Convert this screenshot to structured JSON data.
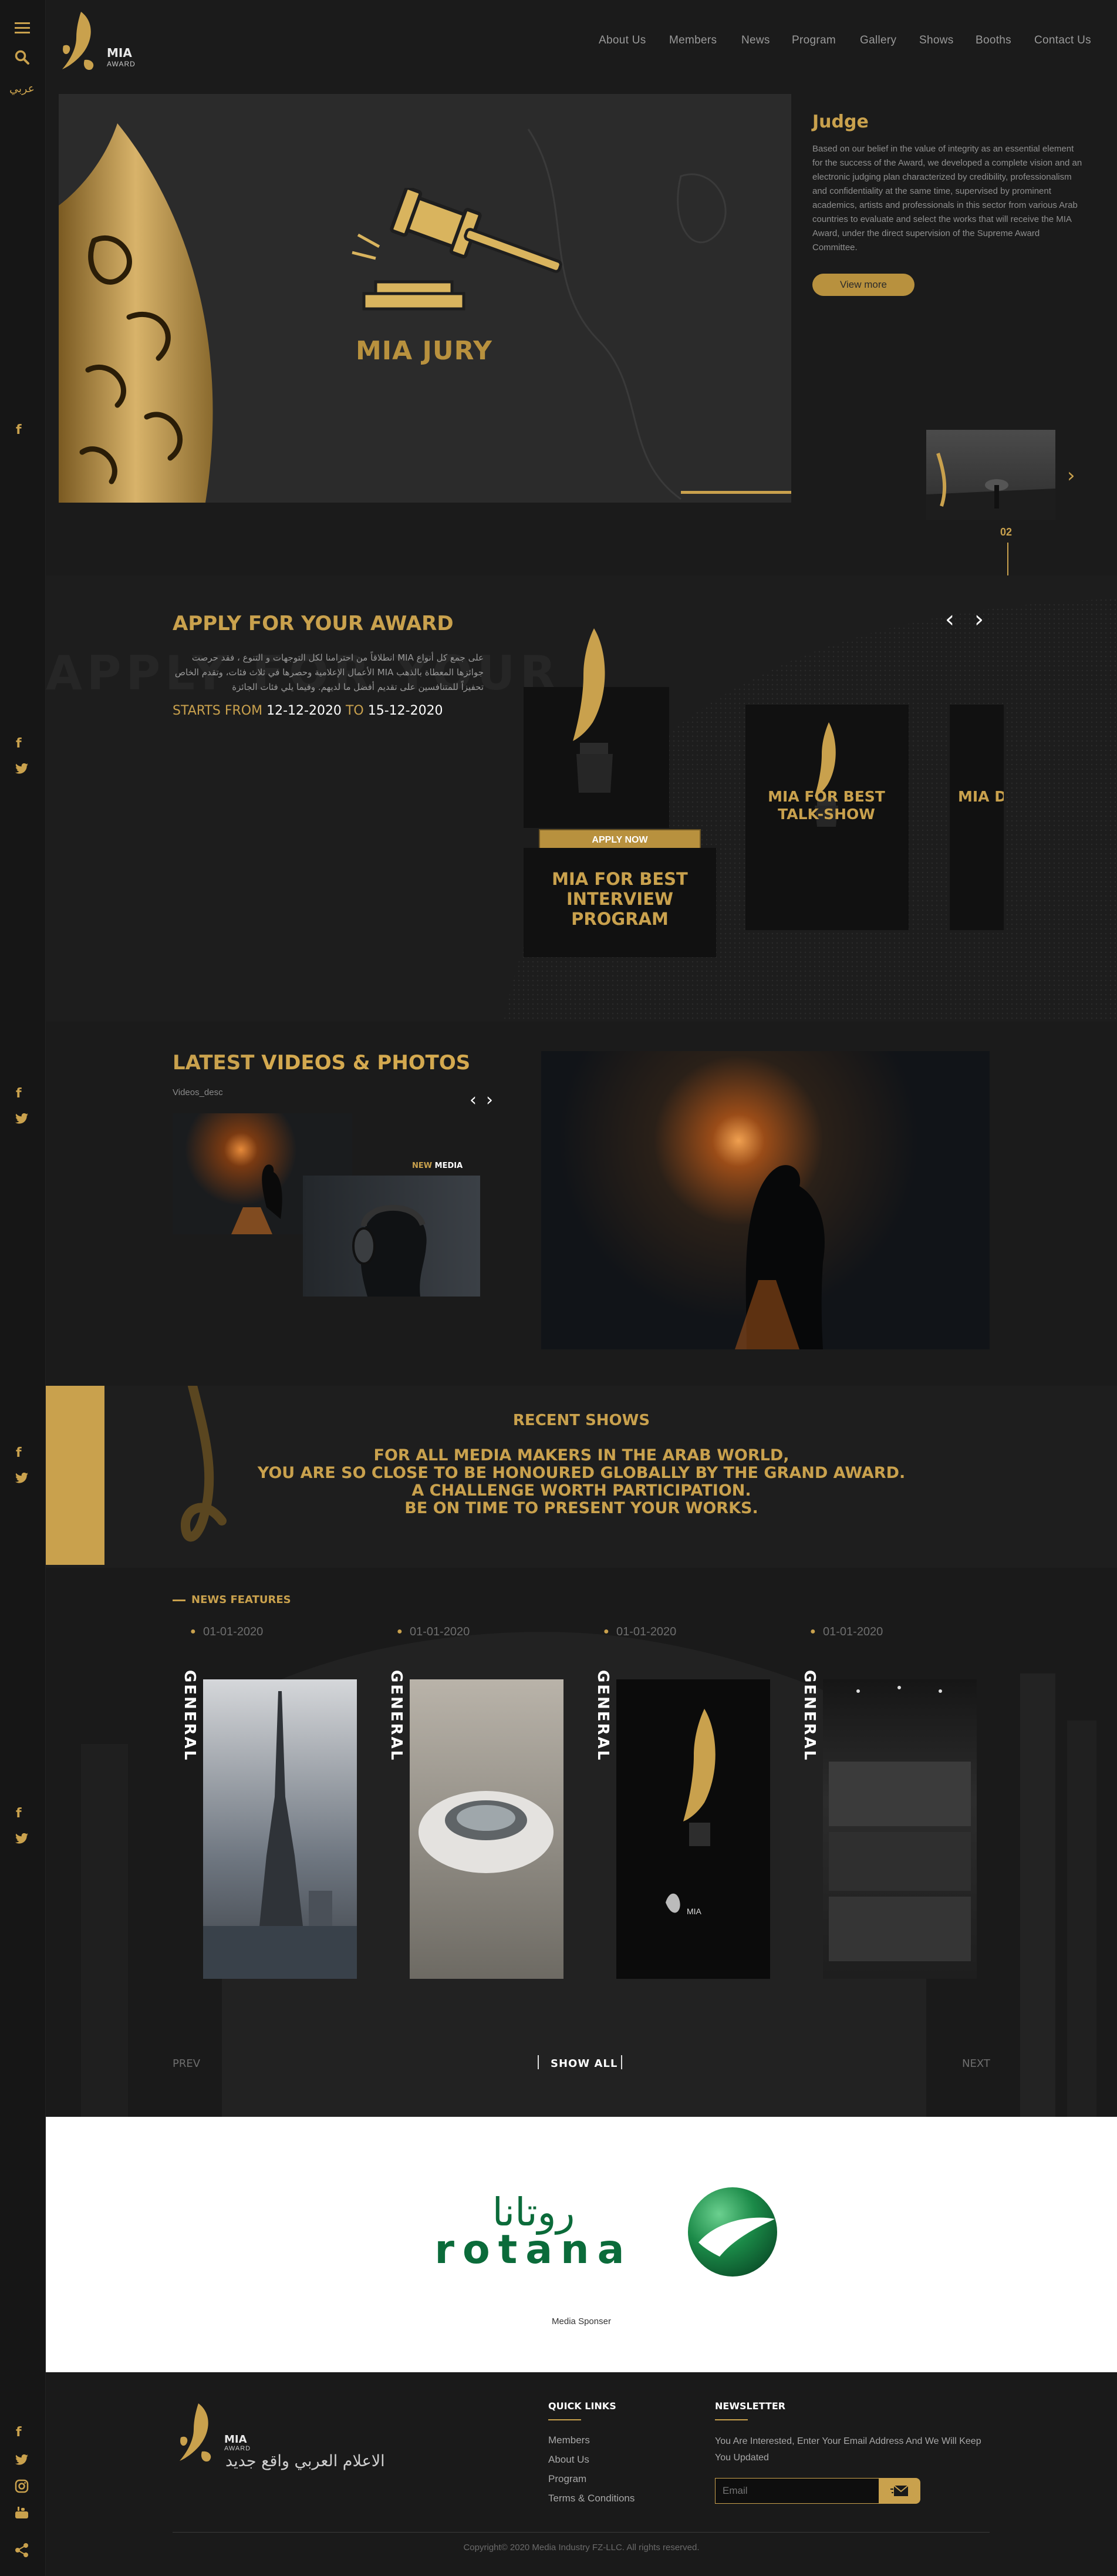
{
  "rail": {
    "menu_icon": "hamburger-icon",
    "search_icon": "search-icon",
    "lang": "عربي",
    "social_fb": "f"
  },
  "brand": {
    "name": "MIA",
    "sub": "AWARD"
  },
  "nav": [
    "About Us",
    "Members",
    "News",
    "Program",
    "Gallery",
    "Shows",
    "Booths",
    "Contact Us"
  ],
  "hero": {
    "caption": "MIA JURY",
    "title": "Judge",
    "text": "Based on our belief in the value of integrity as an essential element for the success of the Award, we developed a complete vision and an electronic judging plan characterized by credibility, professionalism and confidentiality at the same time, supervised by prominent academics, artists and professionals in this sector from various Arab countries to evaluate and select the works that will receive the MIA Award, under the direct supervision of the Supreme Award Committee.",
    "button": "View more",
    "slide_num": "02"
  },
  "apply": {
    "title": "APPLY FOR YOUR AWARD",
    "bg_text": "APPLY FOR YOUR",
    "arabic": "على جمع كل أنواع MIA انطلاقاً من احترامنا لكل التوجهات و التنوع ، فقد حرصت جوائزها المعطاة بالذهب MIA الأعمال الإعلامية وحصرها في ثلاث فئات، وتقدم الخاص تحفيزاً للمتنافسين على تقديم أفضل ما لديهم. وفيما يلي فئات الجائزة",
    "starts_label": "STARTS FROM",
    "start_date": "12-12-2020",
    "to_label": "TO",
    "end_date": "15-12-2020",
    "apply_btn": "APPLY NOW",
    "cards": [
      {
        "title": "MIA FOR BEST INTERVIEW PROGRAM"
      },
      {
        "title": "MIA FOR BEST TALK-SHOW"
      },
      {
        "title": "MIA DEBAT"
      }
    ]
  },
  "videos": {
    "title_gold": "LATEST",
    "title_white": "VIDEOS & PHOTOS",
    "desc": "Videos_desc",
    "new_label": "NEW",
    "media_label": "MEDIA"
  },
  "recent": {
    "title": "RECENT SHOWS",
    "lines": [
      "FOR ALL MEDIA MAKERS IN THE ARAB WORLD,",
      "YOU ARE SO CLOSE TO BE HONOURED GLOBALLY BY THE GRAND AWARD.",
      "A CHALLENGE WORTH PARTICIPATION.",
      "BE ON TIME TO PRESENT YOUR WORKS."
    ]
  },
  "news": {
    "title": "NEWS FEATURES",
    "items": [
      {
        "date": "01-01-2020",
        "category": "GENERAL"
      },
      {
        "date": "01-01-2020",
        "category": "GENERAL"
      },
      {
        "date": "01-01-2020",
        "category": "GENERAL"
      },
      {
        "date": "01-01-2020",
        "category": "GENERAL"
      }
    ],
    "prev": "PREV",
    "show_all": "SHOW ALL",
    "next": "NEXT"
  },
  "sponsor": {
    "brand_ar": "روتانا",
    "brand_en": "rotana",
    "caption": "Media Sponser"
  },
  "footer": {
    "tagline": "الاعلام العربي واقع جديد",
    "quick_links_title": "QUICK LINKS",
    "links": [
      "Members",
      "About Us",
      "Program",
      "Terms & Conditions"
    ],
    "newsletter_title": "NEWSLETTER",
    "newsletter_text": "You Are Interested, Enter Your Email Address And We Will Keep You Updated",
    "email_placeholder": "Email",
    "copyright": "Copyright© 2020 Media Industry FZ-LLC. All rights reserved."
  },
  "colors": {
    "accent": "#c9a14d",
    "bg": "#1b1b1b",
    "rotana_green": "#0b6b3a"
  }
}
